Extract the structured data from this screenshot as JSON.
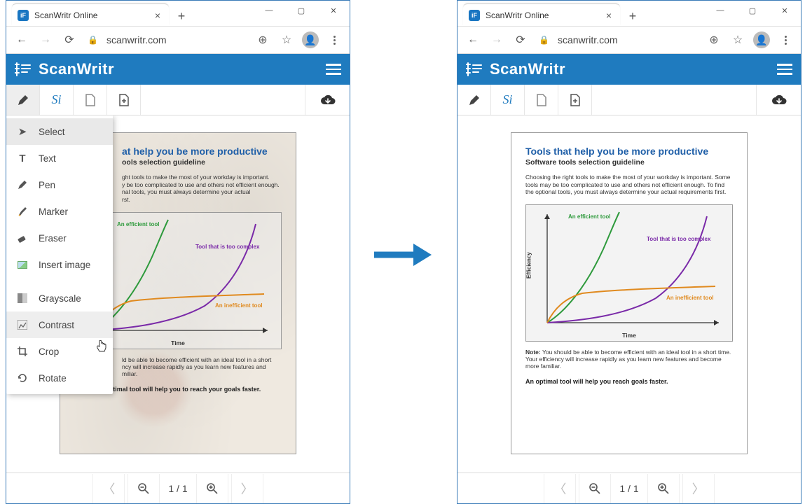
{
  "browser": {
    "tab_title": "ScanWritr Online",
    "favicon_letter": "iF",
    "url_text": "scanwritr.com"
  },
  "app": {
    "brand": "ScanWritr"
  },
  "dropdown": {
    "select": "Select",
    "text": "Text",
    "pen": "Pen",
    "marker": "Marker",
    "eraser": "Eraser",
    "insert_image": "Insert image",
    "grayscale": "Grayscale",
    "contrast": "Contrast",
    "crop": "Crop",
    "rotate": "Rotate"
  },
  "document": {
    "title": "Tools that help you be more productive",
    "subtitle": "Software tools selection guideline",
    "para_full": "Choosing the right tools to make the most of your workday is important. Some tools may be too complicated to use and others not efficient enough. To find the optional tools, you must always determine your actual requirements first.",
    "title_cut": "at help you be more productive",
    "subtitle_cut": "ools selection guideline",
    "para_cut": "ght tools to make the most of your workday is important.\ny be too complicated to use and others not efficient enough.\nnal tools, you must always determine your actual\nrst.",
    "note_label": "Note:",
    "note_full": "You should be able to become efficient with an ideal tool in a short time. Your efficiency will increase rapidly as you learn new features and become more familiar.",
    "note_cut": "ld be able to become efficient with an ideal tool in a short\nncy will increase rapidly as you learn new features and\nmiliar.",
    "optimal_full": "An optimal tool will help you reach goals faster.",
    "optimal_cut": "An optimal tool will help you to reach your goals faster."
  },
  "chart_data": {
    "type": "line",
    "xlabel": "Time",
    "ylabel": "Efficiency",
    "x_range": [
      0,
      10
    ],
    "y_range": [
      0,
      10
    ],
    "series": [
      {
        "name": "An efficient tool",
        "color": "#2e9a3c",
        "label_pos": "top-left",
        "points": [
          [
            0,
            0
          ],
          [
            1,
            1.2
          ],
          [
            2,
            2.6
          ],
          [
            3,
            4.2
          ],
          [
            3.8,
            6.2
          ],
          [
            4.3,
            8.2
          ],
          [
            4.7,
            10
          ]
        ]
      },
      {
        "name": "Tool that is too complex",
        "color": "#7a2aa8",
        "label_pos": "top-right",
        "points": [
          [
            0,
            0
          ],
          [
            2,
            0.25
          ],
          [
            4,
            0.7
          ],
          [
            6,
            1.6
          ],
          [
            7.5,
            3.2
          ],
          [
            8.6,
            5.6
          ],
          [
            9.2,
            7.6
          ],
          [
            9.7,
            9.8
          ]
        ]
      },
      {
        "name": "An inefficient tool",
        "color": "#e08a1f",
        "label_pos": "mid-right",
        "points": [
          [
            0,
            0
          ],
          [
            0.6,
            1.2
          ],
          [
            1.3,
            2.0
          ],
          [
            2.5,
            2.5
          ],
          [
            5,
            2.7
          ],
          [
            10,
            2.8
          ]
        ]
      }
    ]
  },
  "chart_labels": {
    "efficient": "An efficient tool",
    "complex": "Tool that is too complex",
    "inefficient": "An inefficient tool",
    "time": "Time",
    "efficiency": "Efficiency"
  },
  "pager": {
    "page_text": "1  /  1"
  }
}
